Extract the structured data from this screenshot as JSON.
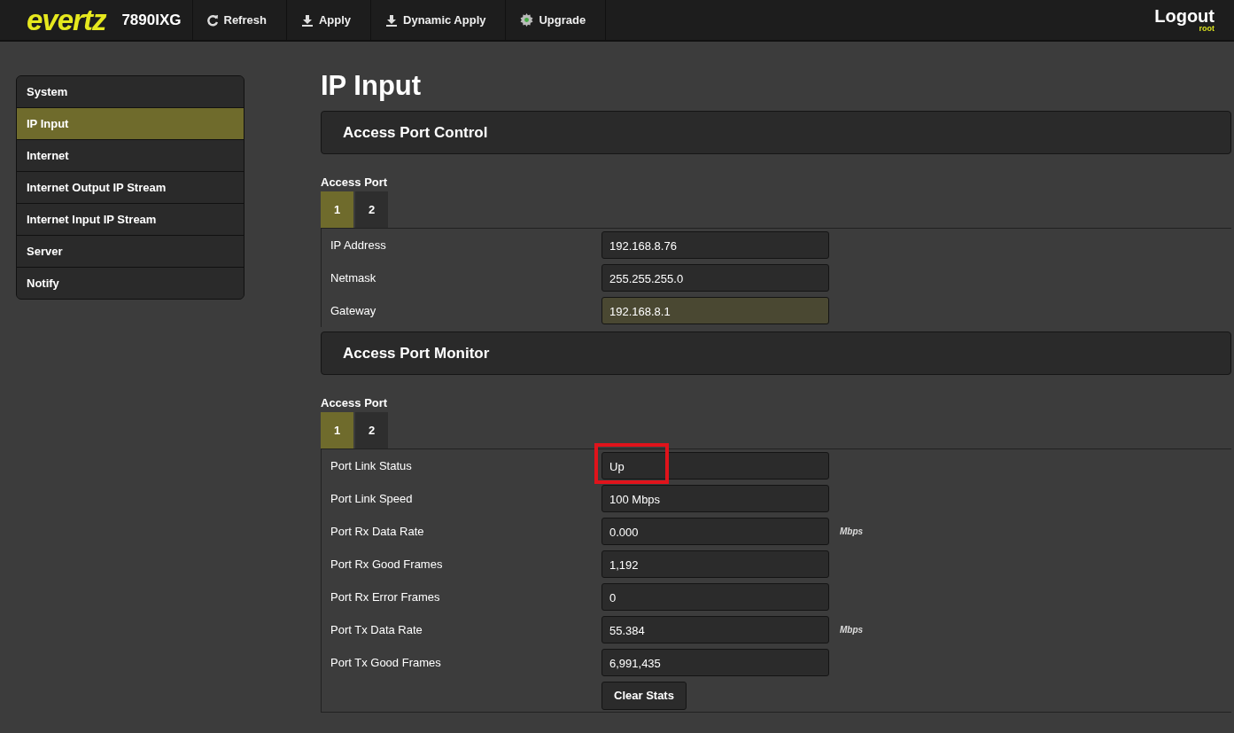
{
  "header": {
    "logo": "evertz",
    "model": "7890IXG",
    "actions": [
      {
        "label": "Refresh",
        "kind": "refresh"
      },
      {
        "label": "Apply",
        "kind": "download"
      },
      {
        "label": "Dynamic Apply",
        "kind": "download"
      },
      {
        "label": "Upgrade",
        "kind": "gear"
      }
    ],
    "logout": "Logout",
    "user": "root"
  },
  "sidebar": {
    "items": [
      {
        "label": "System",
        "selected": false
      },
      {
        "label": "IP Input",
        "selected": true
      },
      {
        "label": "Internet",
        "selected": false
      },
      {
        "label": "Internet Output IP Stream",
        "selected": false
      },
      {
        "label": "Internet Input IP Stream",
        "selected": false
      },
      {
        "label": "Server",
        "selected": false
      },
      {
        "label": "Notify",
        "selected": false
      }
    ]
  },
  "page_title": "IP Input",
  "sections": [
    {
      "title": "Access Port Control",
      "port_label": "Access Port",
      "tabs": [
        {
          "label": "1",
          "selected": true
        },
        {
          "label": "2",
          "selected": false
        }
      ],
      "rows": [
        {
          "label": "IP Address",
          "value": "192.168.8.76",
          "focused": false,
          "highlighted": false
        },
        {
          "label": "Netmask",
          "value": "255.255.255.0",
          "focused": false,
          "highlighted": false
        },
        {
          "label": "Gateway",
          "value": "192.168.8.1",
          "focused": true,
          "highlighted": false
        }
      ]
    },
    {
      "title": "Access Port Monitor",
      "port_label": "Access Port",
      "tabs": [
        {
          "label": "1",
          "selected": true
        },
        {
          "label": "2",
          "selected": false
        }
      ],
      "rows": [
        {
          "label": "Port Link Status",
          "value": "Up",
          "focused": false,
          "highlighted": true
        },
        {
          "label": "Port Link Speed",
          "value": "100 Mbps",
          "focused": false,
          "highlighted": false
        },
        {
          "label": "Port Rx Data Rate",
          "value": "0.000",
          "unit": "Mbps",
          "focused": false,
          "highlighted": false
        },
        {
          "label": "Port Rx Good Frames",
          "value": "1,192",
          "focused": false,
          "highlighted": false
        },
        {
          "label": "Port Rx Error Frames",
          "value": "0",
          "focused": false,
          "highlighted": false
        },
        {
          "label": "Port Tx Data Rate",
          "value": "55.384",
          "unit": "Mbps",
          "focused": false,
          "highlighted": false
        },
        {
          "label": "Port Tx Good Frames",
          "value": "6,991,435",
          "focused": false,
          "highlighted": false
        }
      ],
      "button": "Clear Stats"
    }
  ]
}
